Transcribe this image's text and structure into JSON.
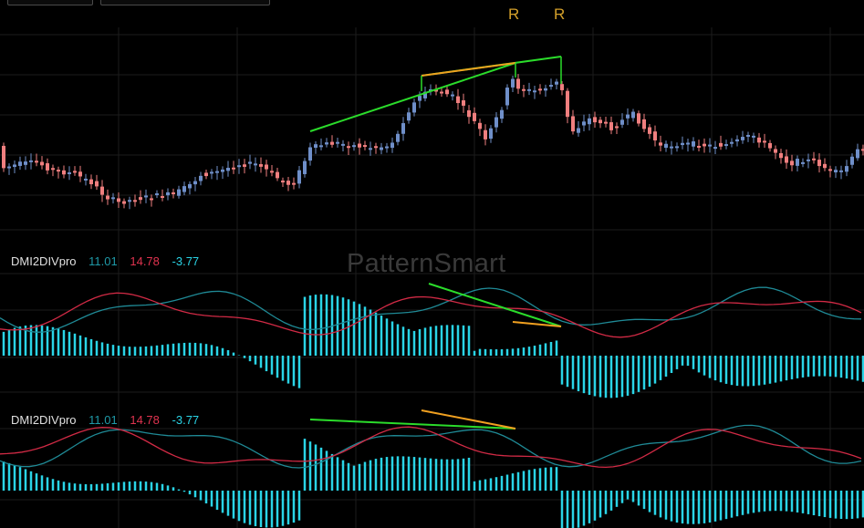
{
  "toolbar": {
    "boxes": [
      "",
      ""
    ]
  },
  "watermark": "PatternSmart",
  "labels": {
    "r1": "R",
    "r2": "R"
  },
  "colors": {
    "background": "#000000",
    "grid": "#1c1c1c",
    "candle_up": "#6f8fc9",
    "candle_down": "#f07f7f",
    "di_plus": "#1f8a96",
    "di_minus": "#d12a45",
    "histogram": "#2ad4e6",
    "trend_green": "#2bdc2b",
    "trend_orange": "#f0a020"
  },
  "indicators": [
    {
      "name": "DMI2DIVpro",
      "v1": "11.01",
      "v2": "14.78",
      "v3": "-3.77"
    },
    {
      "name": "DMI2DIVpro",
      "v1": "11.01",
      "v2": "14.78",
      "v3": "-3.77"
    }
  ],
  "chart_data": {
    "type": "candlestick-with-indicator-panels",
    "grid": true,
    "annotations": [
      "R",
      "R"
    ]
  }
}
